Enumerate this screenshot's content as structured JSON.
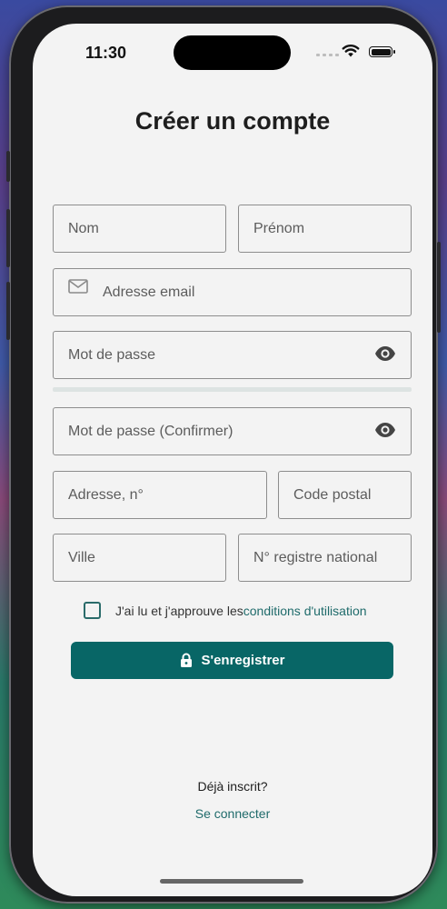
{
  "status_bar": {
    "time": "11:30"
  },
  "page": {
    "title": "Créer un compte"
  },
  "form": {
    "nom": {
      "placeholder": "Nom"
    },
    "prenom": {
      "placeholder": "Prénom"
    },
    "email": {
      "placeholder": "Adresse email",
      "icon": "mail-icon"
    },
    "password": {
      "placeholder": "Mot de passe",
      "icon": "eye-icon"
    },
    "password_confirm": {
      "placeholder": "Mot de passe (Confirmer)",
      "icon": "eye-icon"
    },
    "address": {
      "placeholder": "Adresse, n°"
    },
    "postal_code": {
      "placeholder": "Code postal"
    },
    "city": {
      "placeholder": "Ville"
    },
    "national_register": {
      "placeholder": "N° registre national"
    }
  },
  "terms": {
    "text": "J'ai lu et j'approuve les ",
    "link": "conditions d'utilisation",
    "checked": false
  },
  "submit": {
    "label": "S'enregistrer",
    "icon": "lock-icon"
  },
  "footer": {
    "already": "Déjà inscrit?",
    "login_link": "Se connecter"
  },
  "colors": {
    "accent": "#086666",
    "link": "#1f6b6b",
    "background": "#f3f3f3"
  }
}
